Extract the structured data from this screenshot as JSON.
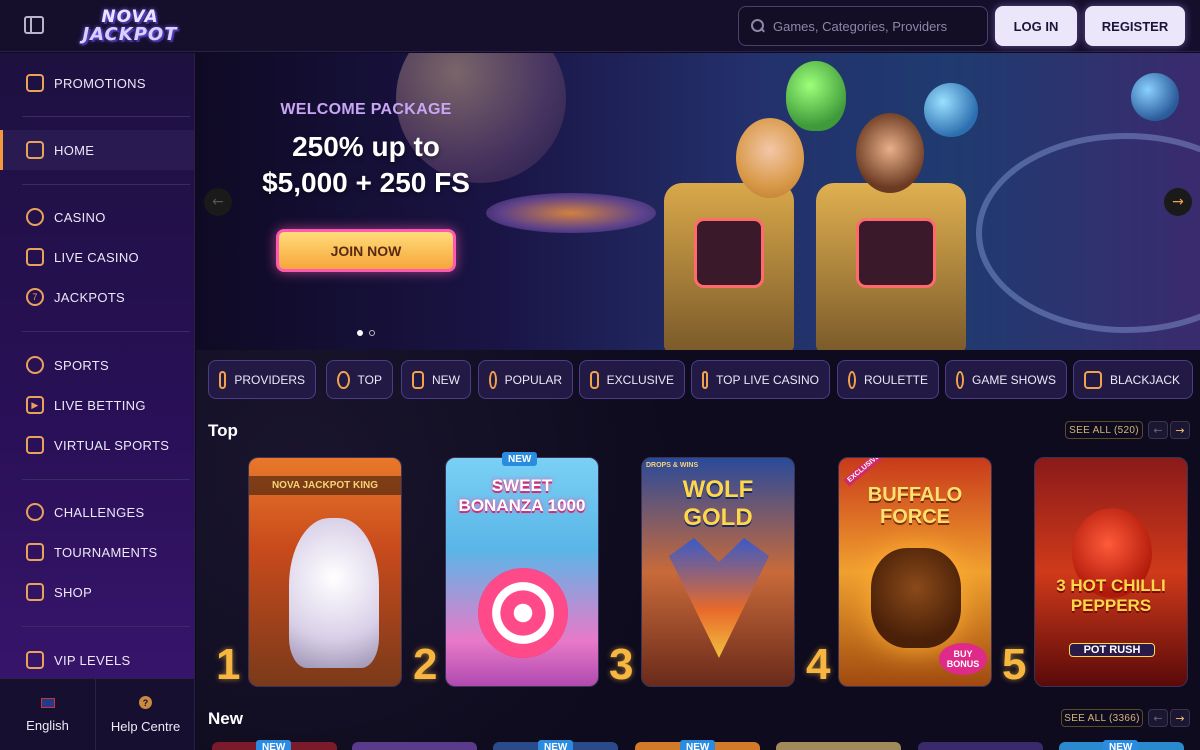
{
  "header": {
    "logo_line1": "NOVA",
    "logo_line2": "JACKPOT",
    "search_placeholder": "Games, Categories, Providers",
    "login_label": "LOG IN",
    "register_label": "REGISTER"
  },
  "sidebar": {
    "items": [
      {
        "label": "PROMOTIONS",
        "icon": "gift-icon"
      },
      {
        "label": "HOME",
        "icon": "home-icon",
        "active": true
      },
      {
        "label": "CASINO",
        "icon": "chip-icon"
      },
      {
        "label": "LIVE CASINO",
        "icon": "spade-icon"
      },
      {
        "label": "JACKPOTS",
        "icon": "seven-icon"
      },
      {
        "label": "SPORTS",
        "icon": "soccer-ball-icon"
      },
      {
        "label": "LIVE BETTING",
        "icon": "play-icon"
      },
      {
        "label": "VIRTUAL SPORTS",
        "icon": "gamepad-icon"
      },
      {
        "label": "CHALLENGES",
        "icon": "medal-icon"
      },
      {
        "label": "TOURNAMENTS",
        "icon": "trophy-icon"
      },
      {
        "label": "SHOP",
        "icon": "shop-icon"
      },
      {
        "label": "VIP LEVELS",
        "icon": "diamond-icon"
      }
    ],
    "language": "English",
    "help": "Help Centre"
  },
  "hero": {
    "subtitle": "WELCOME PACKAGE",
    "title_line1": "250% up to",
    "title_line2": "$5,000 + 250 FS",
    "cta": "JOIN NOW",
    "slides": 2,
    "active_slide": 1
  },
  "categories": [
    {
      "label": "PROVIDERS",
      "icon": "grid-icon"
    },
    {
      "label": "TOP",
      "icon": "award-icon"
    },
    {
      "label": "NEW",
      "icon": "rocket-icon"
    },
    {
      "label": "POPULAR",
      "icon": "flame-icon"
    },
    {
      "label": "EXCLUSIVE",
      "icon": "diamond-icon"
    },
    {
      "label": "TOP LIVE CASINO",
      "icon": "star-icon"
    },
    {
      "label": "ROULETTE",
      "icon": "roulette-icon"
    },
    {
      "label": "GAME SHOWS",
      "icon": "wheel-icon"
    },
    {
      "label": "BLACKJACK",
      "icon": "spade-icon"
    }
  ],
  "top_section": {
    "title": "Top",
    "see_all": "SEE ALL (520)",
    "games": [
      {
        "rank": "1",
        "name": "NOVA JACKPOT KING"
      },
      {
        "rank": "2",
        "name": "SWEET BONANZA 1000",
        "badge": "NEW"
      },
      {
        "rank": "3",
        "name": "WOLF GOLD",
        "tag": "DROPS & WINS"
      },
      {
        "rank": "4",
        "name": "BUFFALO FORCE",
        "tag": "EXCLUSIVE",
        "sticker": "BUY BONUS"
      },
      {
        "rank": "5",
        "name": "3 HOT CHILLI PEPPERS",
        "sub": "POT RUSH"
      }
    ]
  },
  "new_section": {
    "title": "New",
    "see_all": "SEE ALL (3366)",
    "badge": "NEW"
  },
  "colors": {
    "accent": "#f2a24a",
    "background": "#0d0a1c",
    "sidebar": "#1d1140"
  }
}
